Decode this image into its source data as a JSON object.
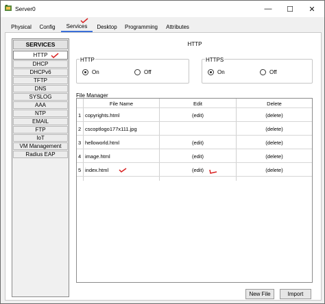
{
  "window": {
    "title": "Server0"
  },
  "title_buttons": {
    "minimize": "—",
    "maximize": "☐",
    "close": "✕"
  },
  "tabs": [
    {
      "label": "Physical"
    },
    {
      "label": "Config"
    },
    {
      "label": "Services",
      "active": true
    },
    {
      "label": "Desktop"
    },
    {
      "label": "Programming"
    },
    {
      "label": "Attributes"
    }
  ],
  "sidebar": {
    "header": "SERVICES",
    "items": [
      {
        "label": "HTTP",
        "selected": true
      },
      {
        "label": "DHCP"
      },
      {
        "label": "DHCPv6"
      },
      {
        "label": "TFTP"
      },
      {
        "label": "DNS"
      },
      {
        "label": "SYSLOG"
      },
      {
        "label": "AAA"
      },
      {
        "label": "NTP"
      },
      {
        "label": "EMAIL"
      },
      {
        "label": "FTP"
      },
      {
        "label": "IoT"
      },
      {
        "label": "VM Management"
      },
      {
        "label": "Radius EAP"
      }
    ]
  },
  "main": {
    "title": "HTTP",
    "http": {
      "label": "HTTP",
      "on": "On",
      "off": "Off",
      "selected": "On"
    },
    "https": {
      "label": "HTTPS",
      "on": "On",
      "off": "Off",
      "selected": "On"
    }
  },
  "file_manager": {
    "label": "File Manager",
    "columns": [
      "File Name",
      "Edit",
      "Delete"
    ],
    "rows": [
      {
        "num": "1",
        "name": "copyrights.html",
        "edit": "(edit)",
        "delete": "(delete)"
      },
      {
        "num": "2",
        "name": "cscoptlogo177x111.jpg",
        "edit": "",
        "delete": "(delete)"
      },
      {
        "num": "3",
        "name": "helloworld.html",
        "edit": "(edit)",
        "delete": "(delete)"
      },
      {
        "num": "4",
        "name": "image.html",
        "edit": "(edit)",
        "delete": "(delete)"
      },
      {
        "num": "5",
        "name": "index.html",
        "edit": "(edit)",
        "delete": "(delete)"
      }
    ]
  },
  "buttons": {
    "new_file": "New File",
    "import": "Import"
  },
  "colors": {
    "annotation": "#d81e1e",
    "active_tab": "#3a6fd8"
  }
}
